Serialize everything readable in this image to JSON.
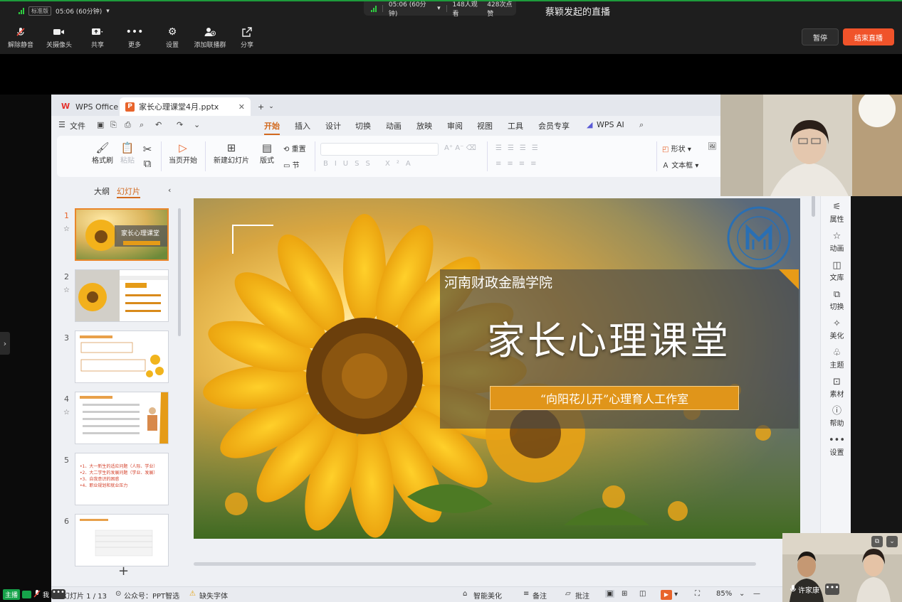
{
  "meeting": {
    "network_label": "标准版",
    "duration_left": "05:06 (60分钟)",
    "duration_center": "05:06 (60分钟)",
    "viewers": "148人观看",
    "likes": "428次点赞",
    "title": "蔡颖发起的直播",
    "toolbar": [
      {
        "label": "解除静音",
        "icon": "mic-muted-icon"
      },
      {
        "label": "关摄像头",
        "icon": "camera-icon"
      },
      {
        "label": "共享",
        "icon": "share-screen-icon"
      },
      {
        "label": "更多",
        "icon": "more-icon"
      },
      {
        "label": "设置",
        "icon": "gear-icon"
      },
      {
        "label": "添加联播群",
        "icon": "add-group-icon"
      },
      {
        "label": "分享",
        "icon": "share-icon"
      }
    ],
    "pause_label": "暂停",
    "end_label": "结束直播",
    "accent_end": "#f0532a"
  },
  "wps": {
    "tabs": {
      "home": "WPS Office",
      "file": "家长心理课堂4月.pptx"
    },
    "menu": {
      "file": "文件",
      "items": [
        "开始",
        "插入",
        "设计",
        "切换",
        "动画",
        "放映",
        "审阅",
        "视图",
        "工具",
        "会员专享",
        "WPS AI"
      ]
    },
    "ribbon": {
      "format_painter": "格式刷",
      "paste": "粘贴",
      "play_from_current": "当页开始",
      "new_slide": "新建幻灯片",
      "layout": "版式",
      "reset": "重置",
      "section": "节",
      "shape": "形状",
      "textbox": "文本框"
    },
    "panel": {
      "outline_tab": "大纲",
      "slides_tab": "幻灯片",
      "slides": [
        {
          "num": "1"
        },
        {
          "num": "2"
        },
        {
          "num": "3"
        },
        {
          "num": "4"
        },
        {
          "num": "5",
          "lines": [
            "•1、大一新生的适应问题（人际、学业）",
            "•2、大二学生的发展问题（学业、发展）",
            "•3、自我意识的困惑",
            "•4、职业规划和就业压力"
          ]
        },
        {
          "num": "6"
        }
      ]
    },
    "slide": {
      "school": "河南财政金融学院",
      "title": "家长心理课堂",
      "subtitle": "“向阳花儿开”心理育人工作室"
    },
    "right_panel": [
      "属性",
      "动画",
      "文库",
      "切换",
      "美化",
      "主题",
      "素材",
      "帮助",
      "设置"
    ],
    "status": {
      "slide_count": "幻灯片 1 / 13",
      "account": "公众号：PPT智选",
      "missing_font": "缺失字体",
      "smart_beautify": "智能美化",
      "notes": "备注",
      "comments": "批注",
      "zoom": "85%"
    }
  },
  "participants": {
    "small_name": "许家康",
    "host_badge": "主播",
    "host_name": "我"
  }
}
